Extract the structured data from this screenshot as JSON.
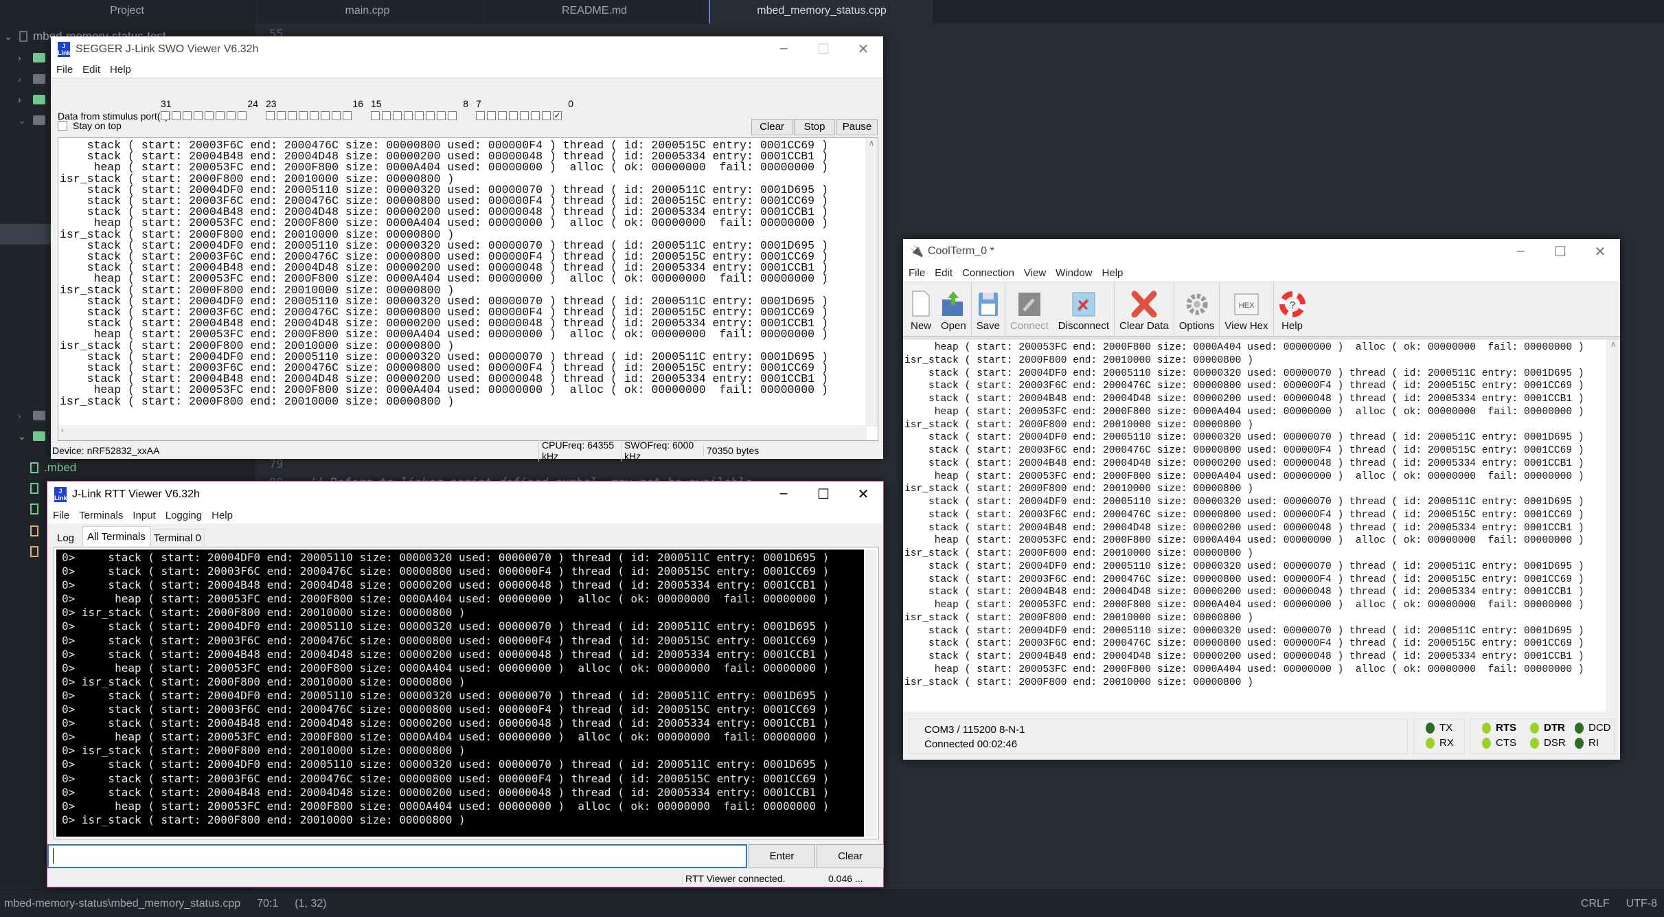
{
  "ide": {
    "tabs": [
      "Project",
      "main.cpp",
      "README.md",
      "mbed_memory_status.cpp"
    ],
    "project_root": "mbed-memory-status-test",
    "mbed_file": ".mbed",
    "editor_lines": [
      {
        "num": "55",
        "text": ""
      },
      {
        "num": "79",
        "text": ""
      },
      {
        "num": "80",
        "text": "// Refers to linker script defined symbol, may not be available"
      }
    ],
    "status": {
      "path": "mbed-memory-status\\mbed_memory_status.cpp",
      "cursor": "70:1",
      "selection": "(1, 32)",
      "line_ending": "CRLF",
      "encoding": "UTF-8"
    }
  },
  "swo": {
    "title": "SEGGER J-Link SWO Viewer V6.32h",
    "menu": [
      "File",
      "Edit",
      "Help"
    ],
    "stimulus_label": "Data from stimulus port(s):",
    "port_groups": [
      [
        "31",
        "24"
      ],
      [
        "23",
        "16"
      ],
      [
        "15",
        "8"
      ],
      [
        "7",
        "0"
      ]
    ],
    "port0_checked": true,
    "stay_on_top": "Stay on top",
    "stay_on_top_checked": false,
    "buttons": [
      "Clear",
      "Stop",
      "Pause"
    ],
    "status": {
      "device": "Device: nRF52832_xxAA",
      "cpu": "CPUFreq: 64355 kHz",
      "swo": "SWOFreq: 6000 kHz",
      "bytes": "70350 bytes"
    },
    "lines": [
      "    stack ( start: 20003F6C end: 2000476C size: 00000800 used: 000000F4 ) thread ( id: 2000515C entry: 0001CC69 )",
      "    stack ( start: 20004B48 end: 20004D48 size: 00000200 used: 00000048 ) thread ( id: 20005334 entry: 0001CCB1 )",
      "     heap ( start: 200053FC end: 2000F800 size: 0000A404 used: 00000000 )  alloc ( ok: 00000000  fail: 00000000 )",
      "isr_stack ( start: 2000F800 end: 20010000 size: 00000800 )",
      "    stack ( start: 20004DF0 end: 20005110 size: 00000320 used: 00000070 ) thread ( id: 2000511C entry: 0001D695 )",
      "    stack ( start: 20003F6C end: 2000476C size: 00000800 used: 000000F4 ) thread ( id: 2000515C entry: 0001CC69 )",
      "    stack ( start: 20004B48 end: 20004D48 size: 00000200 used: 00000048 ) thread ( id: 20005334 entry: 0001CCB1 )",
      "     heap ( start: 200053FC end: 2000F800 size: 0000A404 used: 00000000 )  alloc ( ok: 00000000  fail: 00000000 )",
      "isr_stack ( start: 2000F800 end: 20010000 size: 00000800 )",
      "    stack ( start: 20004DF0 end: 20005110 size: 00000320 used: 00000070 ) thread ( id: 2000511C entry: 0001D695 )",
      "    stack ( start: 20003F6C end: 2000476C size: 00000800 used: 000000F4 ) thread ( id: 2000515C entry: 0001CC69 )",
      "    stack ( start: 20004B48 end: 20004D48 size: 00000200 used: 00000048 ) thread ( id: 20005334 entry: 0001CCB1 )",
      "     heap ( start: 200053FC end: 2000F800 size: 0000A404 used: 00000000 )  alloc ( ok: 00000000  fail: 00000000 )",
      "isr_stack ( start: 2000F800 end: 20010000 size: 00000800 )",
      "    stack ( start: 20004DF0 end: 20005110 size: 00000320 used: 00000070 ) thread ( id: 2000511C entry: 0001D695 )",
      "    stack ( start: 20003F6C end: 2000476C size: 00000800 used: 000000F4 ) thread ( id: 2000515C entry: 0001CC69 )",
      "    stack ( start: 20004B48 end: 20004D48 size: 00000200 used: 00000048 ) thread ( id: 20005334 entry: 0001CCB1 )",
      "     heap ( start: 200053FC end: 2000F800 size: 0000A404 used: 00000000 )  alloc ( ok: 00000000  fail: 00000000 )",
      "isr_stack ( start: 2000F800 end: 20010000 size: 00000800 )",
      "    stack ( start: 20004DF0 end: 20005110 size: 00000320 used: 00000070 ) thread ( id: 2000511C entry: 0001D695 )",
      "    stack ( start: 20003F6C end: 2000476C size: 00000800 used: 000000F4 ) thread ( id: 2000515C entry: 0001CC69 )",
      "    stack ( start: 20004B48 end: 20004D48 size: 00000200 used: 00000048 ) thread ( id: 20005334 entry: 0001CCB1 )",
      "     heap ( start: 200053FC end: 2000F800 size: 0000A404 used: 00000000 )  alloc ( ok: 00000000  fail: 00000000 )",
      "isr_stack ( start: 2000F800 end: 20010000 size: 00000800 )"
    ]
  },
  "rtt": {
    "title": "J-Link RTT Viewer V6.32h",
    "menu": [
      "File",
      "Terminals",
      "Input",
      "Logging",
      "Help"
    ],
    "tabs": [
      "Log",
      "All Terminals",
      "Terminal 0"
    ],
    "active_tab": "All Terminals",
    "input_value": "",
    "enter": "Enter",
    "clear": "Clear",
    "status": "RTT Viewer connected.",
    "time": "0.046 ...",
    "lines": [
      "0>     stack ( start: 20004DF0 end: 20005110 size: 00000320 used: 00000070 ) thread ( id: 2000511C entry: 0001D695 )",
      "0>     stack ( start: 20003F6C end: 2000476C size: 00000800 used: 000000F4 ) thread ( id: 2000515C entry: 0001CC69 )",
      "0>     stack ( start: 20004B48 end: 20004D48 size: 00000200 used: 00000048 ) thread ( id: 20005334 entry: 0001CCB1 )",
      "0>      heap ( start: 200053FC end: 2000F800 size: 0000A404 used: 00000000 )  alloc ( ok: 00000000  fail: 00000000 )",
      "0> isr_stack ( start: 2000F800 end: 20010000 size: 00000800 )",
      "0>     stack ( start: 20004DF0 end: 20005110 size: 00000320 used: 00000070 ) thread ( id: 2000511C entry: 0001D695 )",
      "0>     stack ( start: 20003F6C end: 2000476C size: 00000800 used: 000000F4 ) thread ( id: 2000515C entry: 0001CC69 )",
      "0>     stack ( start: 20004B48 end: 20004D48 size: 00000200 used: 00000048 ) thread ( id: 20005334 entry: 0001CCB1 )",
      "0>      heap ( start: 200053FC end: 2000F800 size: 0000A404 used: 00000000 )  alloc ( ok: 00000000  fail: 00000000 )",
      "0> isr_stack ( start: 2000F800 end: 20010000 size: 00000800 )",
      "0>     stack ( start: 20004DF0 end: 20005110 size: 00000320 used: 00000070 ) thread ( id: 2000511C entry: 0001D695 )",
      "0>     stack ( start: 20003F6C end: 2000476C size: 00000800 used: 000000F4 ) thread ( id: 2000515C entry: 0001CC69 )",
      "0>     stack ( start: 20004B48 end: 20004D48 size: 00000200 used: 00000048 ) thread ( id: 20005334 entry: 0001CCB1 )",
      "0>      heap ( start: 200053FC end: 2000F800 size: 0000A404 used: 00000000 )  alloc ( ok: 00000000  fail: 00000000 )",
      "0> isr_stack ( start: 2000F800 end: 20010000 size: 00000800 )",
      "0>     stack ( start: 20004DF0 end: 20005110 size: 00000320 used: 00000070 ) thread ( id: 2000511C entry: 0001D695 )",
      "0>     stack ( start: 20003F6C end: 2000476C size: 00000800 used: 000000F4 ) thread ( id: 2000515C entry: 0001CC69 )",
      "0>     stack ( start: 20004B48 end: 20004D48 size: 00000200 used: 00000048 ) thread ( id: 20005334 entry: 0001CCB1 )",
      "0>      heap ( start: 200053FC end: 2000F800 size: 0000A404 used: 00000000 )  alloc ( ok: 00000000  fail: 00000000 )",
      "0> isr_stack ( start: 2000F800 end: 20010000 size: 00000800 )"
    ]
  },
  "coolterm": {
    "title": "CoolTerm_0 *",
    "menu": [
      "File",
      "Edit",
      "Connection",
      "View",
      "Window",
      "Help"
    ],
    "toolbar": [
      {
        "label": "New",
        "icon": "new-file-icon"
      },
      {
        "label": "Open",
        "icon": "open-folder-icon"
      },
      {
        "label": "Save",
        "icon": "floppy-icon"
      },
      {
        "label": "Connect",
        "icon": "plug-icon",
        "disabled": true
      },
      {
        "label": "Disconnect",
        "icon": "unplug-icon"
      },
      {
        "label": "Clear Data",
        "icon": "red-x-icon"
      },
      {
        "label": "Options",
        "icon": "gear-icon"
      },
      {
        "label": "View Hex",
        "icon": "hex-icon"
      },
      {
        "label": "Help",
        "icon": "lifebuoy-icon"
      }
    ],
    "hex_text": "HEX",
    "status": {
      "port": "COM3 / 115200 8-N-1",
      "connected": "Connected 00:02:46"
    },
    "leds": [
      {
        "label": "TX",
        "on": false
      },
      {
        "label": "RX",
        "on": true
      },
      {
        "label": "RTS",
        "on": true,
        "bold": true
      },
      {
        "label": "CTS",
        "on": true
      },
      {
        "label": "DTR",
        "on": true,
        "bold": true
      },
      {
        "label": "DSR",
        "on": true
      },
      {
        "label": "DCD",
        "on": false
      },
      {
        "label": "RI",
        "on": false
      }
    ],
    "colors": {
      "led_on": "#9ad22a",
      "led_off": "#2f6b22"
    },
    "lines": [
      "     heap ( start: 200053FC end: 2000F800 size: 0000A404 used: 00000000 )  alloc ( ok: 00000000  fail: 00000000 )",
      "isr_stack ( start: 2000F800 end: 20010000 size: 00000800 )",
      "    stack ( start: 20004DF0 end: 20005110 size: 00000320 used: 00000070 ) thread ( id: 2000511C entry: 0001D695 )",
      "    stack ( start: 20003F6C end: 2000476C size: 00000800 used: 000000F4 ) thread ( id: 2000515C entry: 0001CC69 )",
      "    stack ( start: 20004B48 end: 20004D48 size: 00000200 used: 00000048 ) thread ( id: 20005334 entry: 0001CCB1 )",
      "     heap ( start: 200053FC end: 2000F800 size: 0000A404 used: 00000000 )  alloc ( ok: 00000000  fail: 00000000 )",
      "isr_stack ( start: 2000F800 end: 20010000 size: 00000800 )",
      "    stack ( start: 20004DF0 end: 20005110 size: 00000320 used: 00000070 ) thread ( id: 2000511C entry: 0001D695 )",
      "    stack ( start: 20003F6C end: 2000476C size: 00000800 used: 000000F4 ) thread ( id: 2000515C entry: 0001CC69 )",
      "    stack ( start: 20004B48 end: 20004D48 size: 00000200 used: 00000048 ) thread ( id: 20005334 entry: 0001CCB1 )",
      "     heap ( start: 200053FC end: 2000F800 size: 0000A404 used: 00000000 )  alloc ( ok: 00000000  fail: 00000000 )",
      "isr_stack ( start: 2000F800 end: 20010000 size: 00000800 )",
      "    stack ( start: 20004DF0 end: 20005110 size: 00000320 used: 00000070 ) thread ( id: 2000511C entry: 0001D695 )",
      "    stack ( start: 20003F6C end: 2000476C size: 00000800 used: 000000F4 ) thread ( id: 2000515C entry: 0001CC69 )",
      "    stack ( start: 20004B48 end: 20004D48 size: 00000200 used: 00000048 ) thread ( id: 20005334 entry: 0001CCB1 )",
      "     heap ( start: 200053FC end: 2000F800 size: 0000A404 used: 00000000 )  alloc ( ok: 00000000  fail: 00000000 )",
      "isr_stack ( start: 2000F800 end: 20010000 size: 00000800 )",
      "    stack ( start: 20004DF0 end: 20005110 size: 00000320 used: 00000070 ) thread ( id: 2000511C entry: 0001D695 )",
      "    stack ( start: 20003F6C end: 2000476C size: 00000800 used: 000000F4 ) thread ( id: 2000515C entry: 0001CC69 )",
      "    stack ( start: 20004B48 end: 20004D48 size: 00000200 used: 00000048 ) thread ( id: 20005334 entry: 0001CCB1 )",
      "     heap ( start: 200053FC end: 2000F800 size: 0000A404 used: 00000000 )  alloc ( ok: 00000000  fail: 00000000 )",
      "isr_stack ( start: 2000F800 end: 20010000 size: 00000800 )",
      "    stack ( start: 20004DF0 end: 20005110 size: 00000320 used: 00000070 ) thread ( id: 2000511C entry: 0001D695 )",
      "    stack ( start: 20003F6C end: 2000476C size: 00000800 used: 000000F4 ) thread ( id: 2000515C entry: 0001CC69 )",
      "    stack ( start: 20004B48 end: 20004D48 size: 00000200 used: 00000048 ) thread ( id: 20005334 entry: 0001CCB1 )",
      "     heap ( start: 200053FC end: 2000F800 size: 0000A404 used: 00000000 )  alloc ( ok: 00000000  fail: 00000000 )",
      "isr_stack ( start: 2000F800 end: 20010000 size: 00000800 )"
    ]
  }
}
